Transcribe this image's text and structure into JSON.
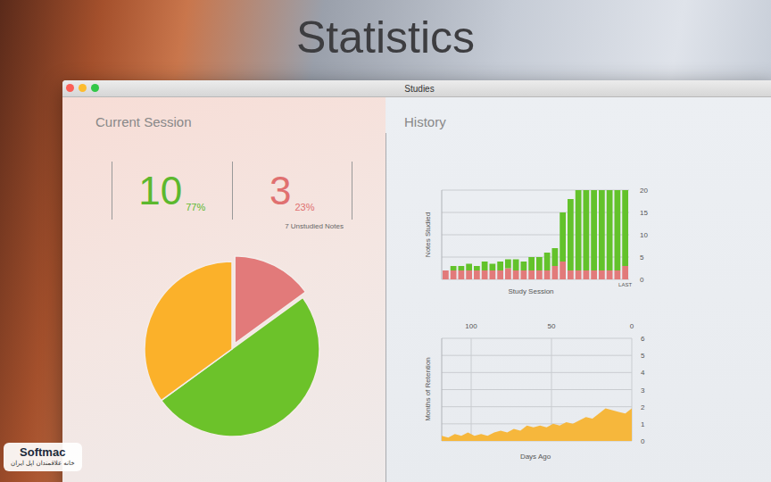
{
  "banner": {
    "title": "Statistics"
  },
  "watermark": {
    "brand": "Softmac",
    "tagline": "خانه علاقمندان اپل ایران"
  },
  "window": {
    "title": "Studies"
  },
  "current_session": {
    "heading": "Current Session",
    "stats": [
      {
        "value": "10",
        "percent": "77%",
        "color": "#5cb82e"
      },
      {
        "value": "3",
        "percent": "23%",
        "color": "#e07070"
      }
    ],
    "note": "7 Unstudied Notes",
    "pie": [
      {
        "value": 3,
        "color": "#e27a7a",
        "exploded": true
      },
      {
        "value": 10,
        "color": "#6cc22a",
        "exploded": false
      },
      {
        "value": 7,
        "color": "#fbb12a",
        "exploded": false
      }
    ]
  },
  "history": {
    "heading": "History",
    "sessions_chart": {
      "y_label": "Notes Studied",
      "x_label": "Study Session",
      "last_label": "LAST",
      "y_ticks": [
        "0",
        "5",
        "10",
        "15",
        "20"
      ],
      "y_max": 20,
      "series": [
        {
          "color": "#e27a7a",
          "values": [
            2,
            2,
            2,
            2,
            2,
            2,
            2,
            2,
            2.5,
            2,
            2,
            2,
            2,
            2,
            3,
            4,
            2,
            2,
            2,
            2,
            2,
            2,
            2,
            3
          ]
        },
        {
          "color": "#63c22b",
          "values": [
            0,
            1,
            1,
            1.5,
            1,
            2,
            1.5,
            2,
            2,
            2.5,
            2,
            3,
            3,
            4,
            4,
            11,
            16,
            18,
            18,
            18,
            18,
            18,
            18,
            17
          ]
        }
      ]
    },
    "retention_chart": {
      "y_label": "Months of Retention",
      "x_label": "Days Ago",
      "x_ticks": [
        "100",
        "50",
        "0"
      ],
      "y_ticks": [
        "0",
        "1",
        "2",
        "3",
        "4",
        "5",
        "6"
      ],
      "y_max": 6,
      "color": "#f6b73c",
      "values": [
        0.3,
        0.2,
        0.4,
        0.3,
        0.5,
        0.3,
        0.4,
        0.3,
        0.5,
        0.6,
        0.5,
        0.7,
        0.6,
        0.9,
        0.8,
        0.9,
        0.8,
        1.0,
        0.9,
        1.1,
        1.0,
        1.2,
        1.4,
        1.3,
        1.6,
        1.9,
        1.8,
        1.7,
        1.6,
        1.9
      ]
    }
  }
}
